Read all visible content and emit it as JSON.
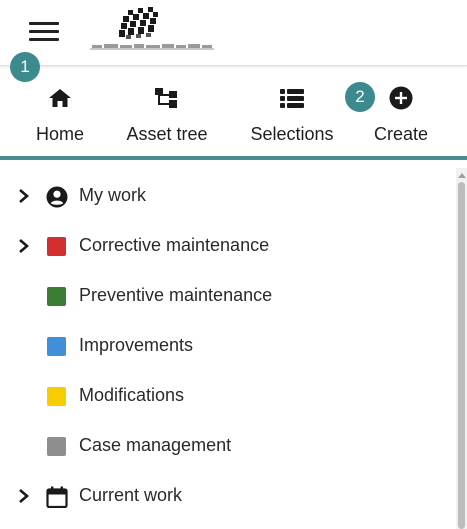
{
  "header": {
    "menu_icon": "hamburger-menu-icon",
    "logo": "company-logo"
  },
  "badges": {
    "first": "1",
    "second": "2"
  },
  "tabs": [
    {
      "label": "Home",
      "icon": "home-icon"
    },
    {
      "label": "Asset tree",
      "icon": "asset-tree-icon"
    },
    {
      "label": "Selections",
      "icon": "list-icon"
    },
    {
      "label": "Create",
      "icon": "add-circle-icon"
    }
  ],
  "accent_color": "#4a8c8f",
  "menu": [
    {
      "label": "My work",
      "expandable": true,
      "icon": "account-circle-icon"
    },
    {
      "label": "Corrective maintenance",
      "expandable": true,
      "color": "#d32f2f"
    },
    {
      "label": "Preventive maintenance",
      "expandable": false,
      "color": "#3b7d34"
    },
    {
      "label": "Improvements",
      "expandable": false,
      "color": "#3f8fd9"
    },
    {
      "label": "Modifications",
      "expandable": false,
      "color": "#f5cd00"
    },
    {
      "label": "Case management",
      "expandable": false,
      "color": "#8e8e8e"
    },
    {
      "label": "Current work",
      "expandable": true,
      "icon": "calendar-icon"
    }
  ]
}
